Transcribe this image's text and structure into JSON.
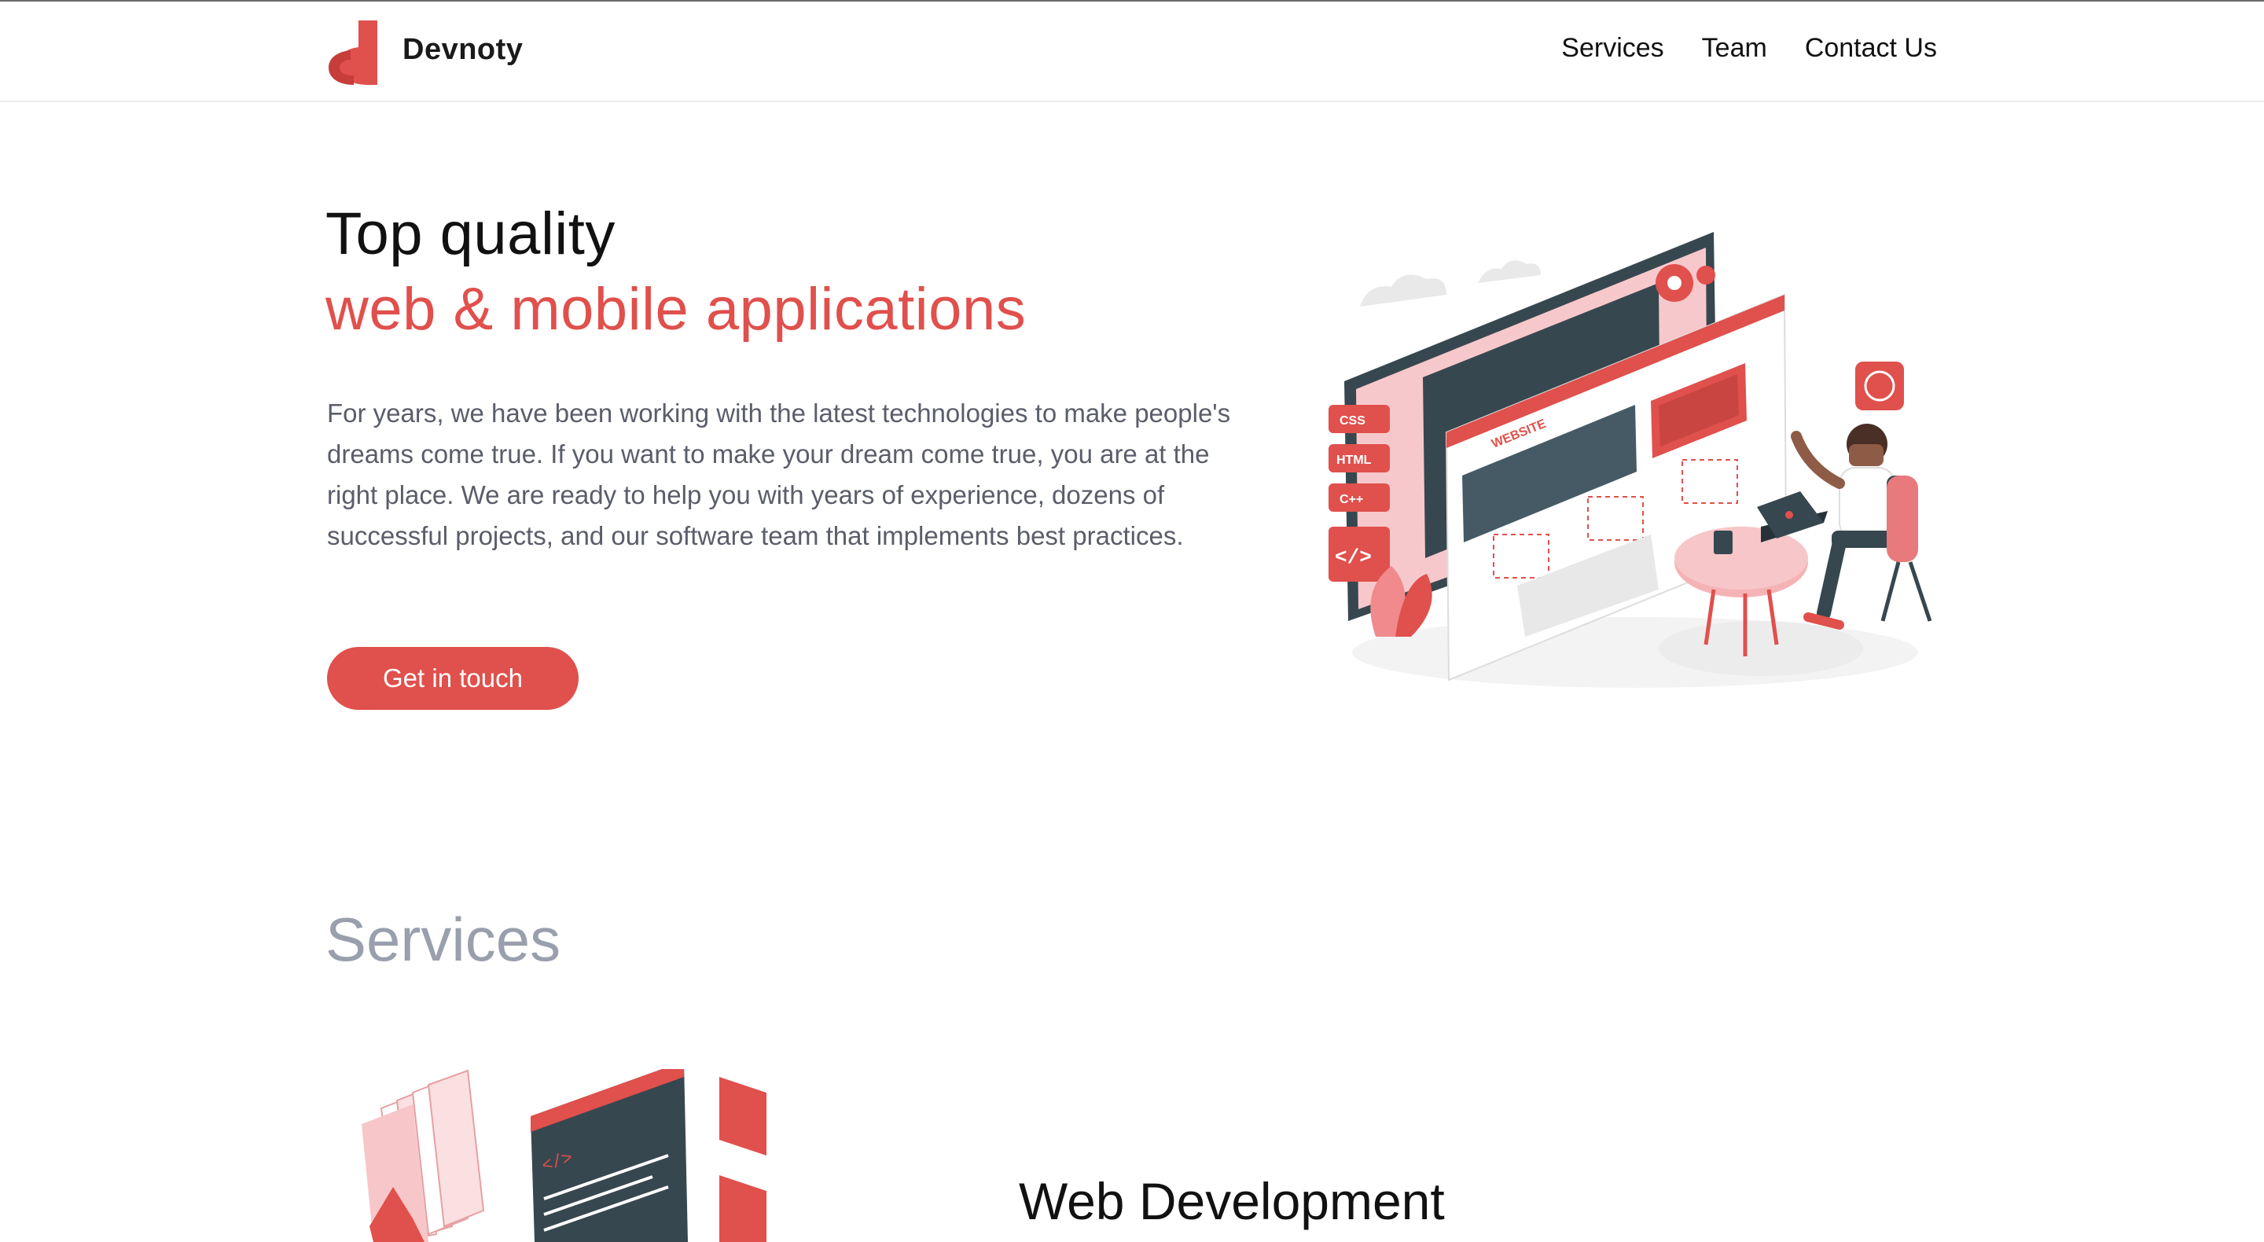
{
  "brand": {
    "name": "Devnoty",
    "accent_color": "#e0504c"
  },
  "nav": {
    "items": [
      "Services",
      "Team",
      "Contact Us"
    ]
  },
  "hero": {
    "title_line1": "Top quality",
    "title_line2": "web & mobile applications",
    "description": "For years, we have been working with the latest technologies to make people's dreams come true. If you want to make your dream come true, you are at the right place. We are ready to help you with years of experience, dozens of successful projects, and our software team that implements best practices.",
    "cta_label": "Get in touch",
    "illustration": {
      "tags": [
        "CSS",
        "HTML",
        "C++"
      ],
      "code_symbol": "</>",
      "website_label": "WEBSITE"
    }
  },
  "services": {
    "heading": "Services",
    "items": [
      {
        "title": "Web Development",
        "illustration": {
          "code_symbol": "</>"
        }
      }
    ]
  }
}
